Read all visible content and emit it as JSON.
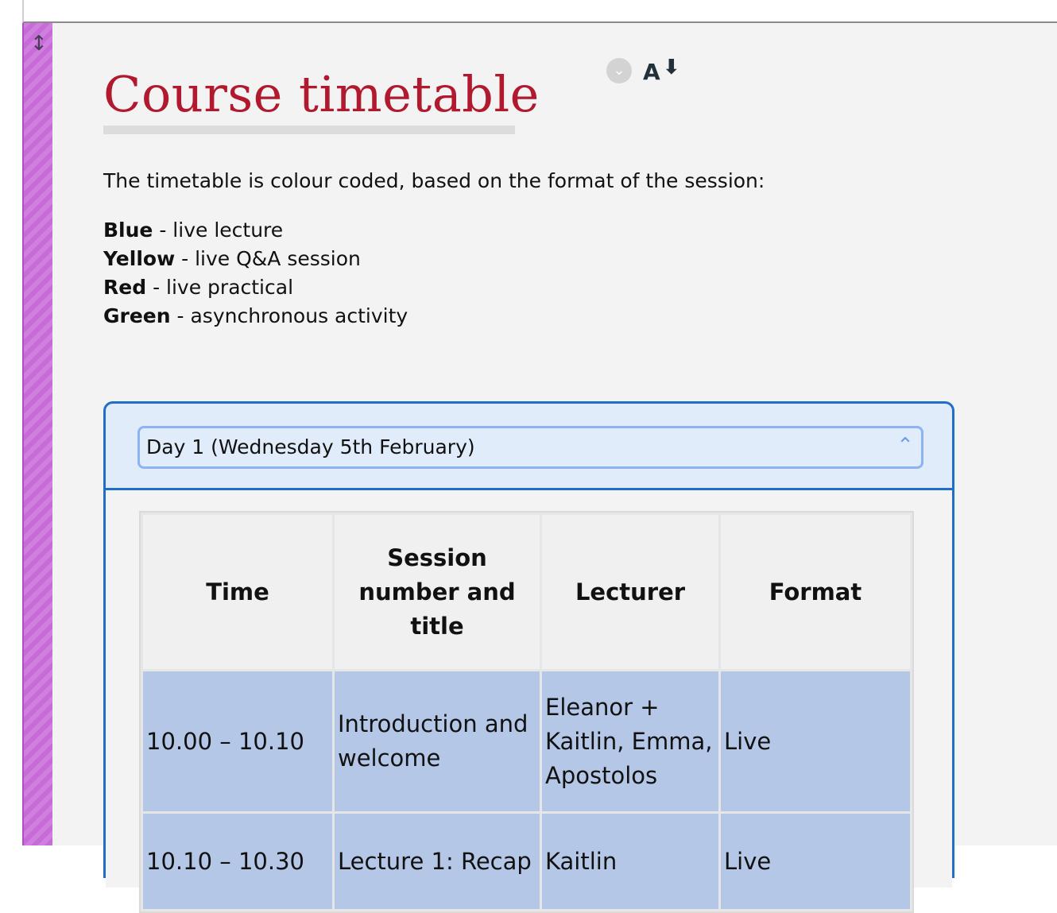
{
  "page": {
    "title": "Course timetable",
    "intro": "The timetable is colour coded, based on the format of the session:",
    "legend": [
      {
        "color_name": "Blue",
        "desc": "- live lecture"
      },
      {
        "color_name": "Yellow",
        "desc": "- live Q&A session"
      },
      {
        "color_name": "Red",
        "desc": "- live practical"
      },
      {
        "color_name": "Green",
        "desc": "- asynchronous activity"
      }
    ],
    "icons": {
      "resize": "vertical-resize-arrow-icon",
      "collapse": "chevron-down-circle-icon",
      "font_size": "font-size-decrease-icon",
      "accordion_toggle": "chevron-up-icon"
    },
    "colors": {
      "title": "#b0192e",
      "accordion_border": "#1f6fc8",
      "live_lecture_row": "#b4c7e7",
      "sidebar_strip": "#c76bd8"
    }
  },
  "accordion": {
    "label": "Day 1 (Wednesday 5th February)",
    "table": {
      "headers": [
        "Time",
        "Session number and title",
        "Lecturer",
        "Format"
      ],
      "rows": [
        [
          "10.00 – 10.10",
          "Introduction and welcome",
          "Eleanor + Kaitlin, Emma, Apostolos",
          "Live"
        ],
        [
          "10.10 – 10.30",
          "Lecture 1: Recap",
          "Kaitlin",
          "Live"
        ]
      ]
    }
  }
}
